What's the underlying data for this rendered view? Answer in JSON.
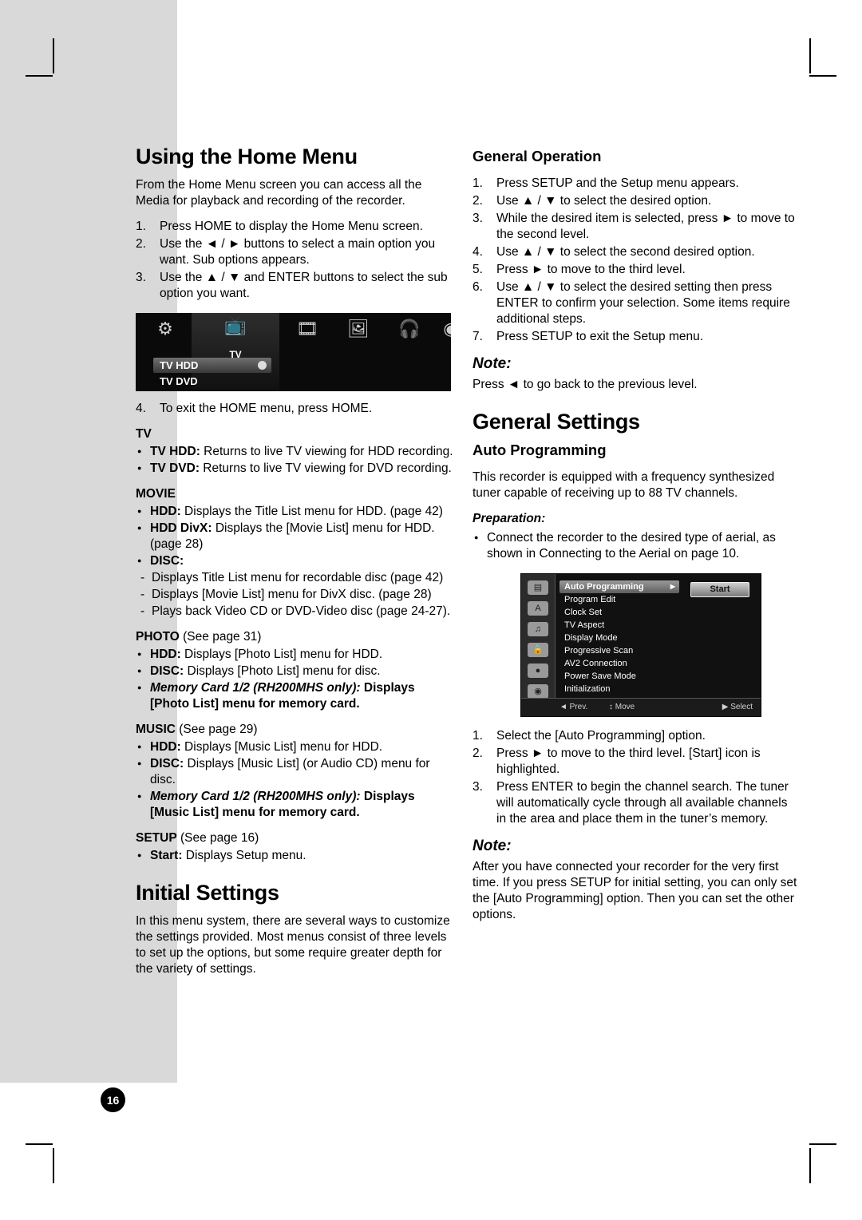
{
  "page": {
    "number": "16"
  },
  "left": {
    "title": "Using the Home Menu",
    "intro": "From the Home Menu screen you can access all the Media for playback and recording of the recorder.",
    "steps": [
      {
        "n": "1.",
        "text": "Press HOME to display the Home Menu screen."
      },
      {
        "n": "2.",
        "text": "Use the ◄ / ► buttons to select a main option you want. Sub options appears."
      },
      {
        "n": "3.",
        "text": "Use the ▲ / ▼ and ENTER buttons to select the sub option you want."
      }
    ],
    "home_screen": {
      "icons": [
        "settings-icon",
        "tv-icon",
        "movie-icon",
        "photo-icon",
        "music-icon",
        "disc-icon"
      ],
      "tv_label": "TV",
      "options": [
        {
          "label": "TV HDD",
          "selected": true
        },
        {
          "label": "TV DVD",
          "selected": false
        }
      ]
    },
    "step4": {
      "n": "4.",
      "text": "To exit the HOME menu, press HOME."
    },
    "groups": [
      {
        "heading": "TV",
        "heading_bold": true,
        "bullets": [
          {
            "bold": "TV HDD:",
            "rest": " Returns to live TV viewing for HDD recording."
          },
          {
            "bold": "TV DVD:",
            "rest": " Returns to live TV viewing for DVD recording."
          }
        ]
      },
      {
        "heading": "MOVIE",
        "heading_bold": true,
        "bullets": [
          {
            "bold": "HDD:",
            "rest": " Displays the Title List menu for HDD. (page 42)"
          },
          {
            "bold": "HDD DivX:",
            "rest": " Displays the [Movie List] menu for HDD. (page 28)"
          },
          {
            "bold": "DISC:",
            "rest": ""
          }
        ],
        "dashes": [
          "Displays Title List menu for recordable disc (page 42)",
          "Displays [Movie List] menu for DivX disc. (page 28)",
          "Plays back Video CD or DVD-Video disc (page 24-27)."
        ]
      },
      {
        "heading": "PHOTO",
        "heading_suffix": " (See page 31)",
        "bullets": [
          {
            "bold": "HDD:",
            "rest": " Displays [Photo List] menu for HDD."
          },
          {
            "bold": "DISC:",
            "rest": " Displays [Photo List] menu for disc."
          },
          {
            "bold": "Memory Card 1/2 (RH200MHS only):",
            "rest": " Displays [Photo List] menu for memory card.",
            "all_bold": true
          }
        ]
      },
      {
        "heading": "MUSIC",
        "heading_suffix": " (See page 29)",
        "bullets": [
          {
            "bold": "HDD:",
            "rest": " Displays [Music List] menu for HDD."
          },
          {
            "bold": "DISC:",
            "rest": " Displays [Music List] (or Audio CD) menu for disc."
          },
          {
            "bold": "Memory Card 1/2 (RH200MHS only):",
            "rest": " Displays [Music List] menu for memory card.",
            "all_bold": true
          }
        ]
      },
      {
        "heading": "SETUP",
        "heading_suffix": " (See page 16)",
        "bullets": [
          {
            "bold": "Start:",
            "rest": " Displays Setup menu."
          }
        ]
      }
    ],
    "initial_settings": {
      "title": "Initial Settings",
      "body": "In this menu system, there are several ways to customize the settings provided. Most menus consist of three levels to set up the options, but some require greater depth for the variety of settings."
    }
  },
  "right": {
    "general_operation": {
      "title": "General Operation",
      "steps": [
        {
          "n": "1.",
          "text": "Press SETUP and the Setup menu appears."
        },
        {
          "n": "2.",
          "text": "Use ▲ / ▼ to select the desired option."
        },
        {
          "n": "3.",
          "text": "While the desired item is selected, press ► to move to the second level."
        },
        {
          "n": "4.",
          "text": "Use ▲ / ▼ to select the second desired option."
        },
        {
          "n": "5.",
          "text": "Press ► to move to the third level."
        },
        {
          "n": "6.",
          "text": "Use ▲ / ▼ to select the desired setting then press ENTER to confirm your selection. Some items require additional steps."
        },
        {
          "n": "7.",
          "text": "Press SETUP to exit the Setup menu."
        }
      ],
      "note_label": "Note:",
      "note_text": "Press ◄ to go back to the previous level."
    },
    "general_settings": {
      "title": "General Settings",
      "auto_programming": {
        "title": "Auto Programming",
        "body": "This recorder is equipped with a frequency synthesized tuner capable of receiving up to 88 TV channels.",
        "preparation_label": "Preparation:",
        "preparation_bullet": "Connect the recorder to the desired type of aerial, as shown in Connecting to the Aerial on page 10.",
        "setup_screen": {
          "menu_items": [
            {
              "label": "Auto Programming",
              "selected": true
            },
            {
              "label": "Program Edit",
              "selected": false
            },
            {
              "label": "Clock Set",
              "selected": false
            },
            {
              "label": "TV Aspect",
              "selected": false
            },
            {
              "label": "Display Mode",
              "selected": false
            },
            {
              "label": "Progressive Scan",
              "selected": false
            },
            {
              "label": "AV2 Connection",
              "selected": false
            },
            {
              "label": "Power Save Mode",
              "selected": false
            },
            {
              "label": "Initialization",
              "selected": false
            }
          ],
          "start_button": "Start",
          "footer": {
            "prev": "◄ Prev.",
            "move": "↕ Move",
            "select": "▶ Select"
          }
        },
        "steps": [
          {
            "n": "1.",
            "text": "Select the [Auto Programming] option."
          },
          {
            "n": "2.",
            "text": "Press ► to move to the third level. [Start] icon is highlighted."
          },
          {
            "n": "3.",
            "text": "Press ENTER to begin the channel search. The tuner will automatically cycle through all available channels in the area and place them in the tuner’s memory."
          }
        ],
        "note_label": "Note:",
        "note_text": "After you have connected your recorder for the very first time. If you press SETUP for initial setting, you can only set the [Auto Programming] option. Then you can set the other options."
      }
    }
  }
}
